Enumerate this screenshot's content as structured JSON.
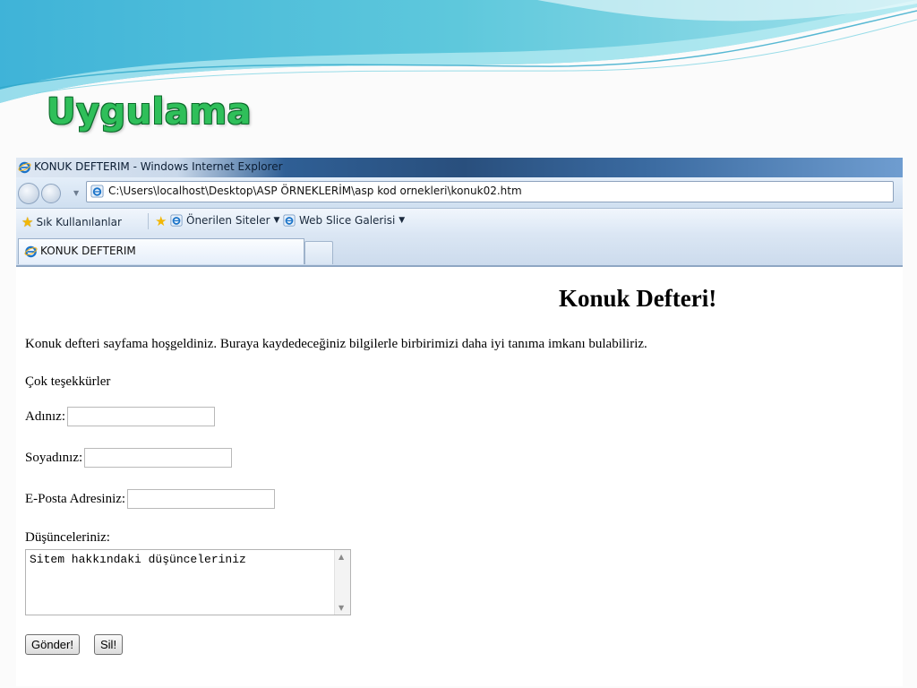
{
  "slide": {
    "title": "Uygulama"
  },
  "window": {
    "title": "KONUK DEFTERIM - Windows Internet Explorer"
  },
  "address_bar": {
    "url": "C:\\Users\\localhost\\Desktop\\ASP ÖRNEKLERİM\\asp kod ornekleri\\konuk02.htm"
  },
  "favorites_bar": {
    "favorites_label": "Sık Kullanılanlar",
    "items": [
      {
        "label": "Önerilen Siteler"
      },
      {
        "label": "Web Slice Galerisi"
      }
    ]
  },
  "tabs": [
    {
      "label": "KONUK DEFTERIM"
    }
  ],
  "page": {
    "heading": "Konuk Defteri!",
    "intro": "Konuk defteri sayfama hoşgeldiniz. Buraya kaydedeceğiniz bilgilerle birbirimizi daha iyi tanıma imkanı bulabiliriz.",
    "thanks": "Çok teşekkürler",
    "form": {
      "first_name_label": "Adınız:",
      "first_name_value": "",
      "last_name_label": "Soyadınız:",
      "last_name_value": "",
      "email_label": "E-Posta Adresiniz:",
      "email_value": "",
      "thoughts_label": "Düşünceleriniz:",
      "thoughts_value": "Sitem hakkındaki düşünceleriniz",
      "submit_label": "Gönder!",
      "reset_label": "Sil!"
    }
  },
  "colors": {
    "slide_title": "#2fbf5a",
    "wave_accent": "#5ec8dc"
  }
}
